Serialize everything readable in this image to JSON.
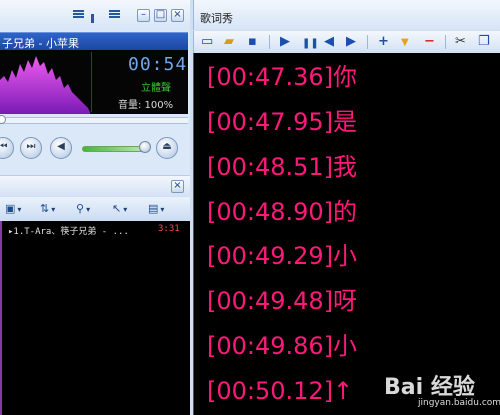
{
  "player": {
    "now_playing": "子兄弟 - 小苹果",
    "time": "00:54",
    "stereo_label": "立體聲",
    "volume_text": "音量: 100%",
    "accent": "#1c47a4",
    "spectrum_color": "#d93fe3"
  },
  "playlist": {
    "rows": [
      {
        "title": "▸1.T-Ara、筷子兄弟 - ...",
        "time": "3:31"
      }
    ]
  },
  "lyrics": {
    "title": "歌词秀",
    "text_color": "#ff1a7a",
    "lines": [
      "[00:47.36]你",
      "[00:47.95]是",
      "[00:48.51]我",
      "[00:48.90]的",
      "[00:49.29]小",
      "[00:49.48]呀",
      "[00:49.86]小",
      "[00:50.12]↑"
    ]
  },
  "watermark": {
    "text": "Bai 经验",
    "sub": "jingyan.baidu.com"
  }
}
